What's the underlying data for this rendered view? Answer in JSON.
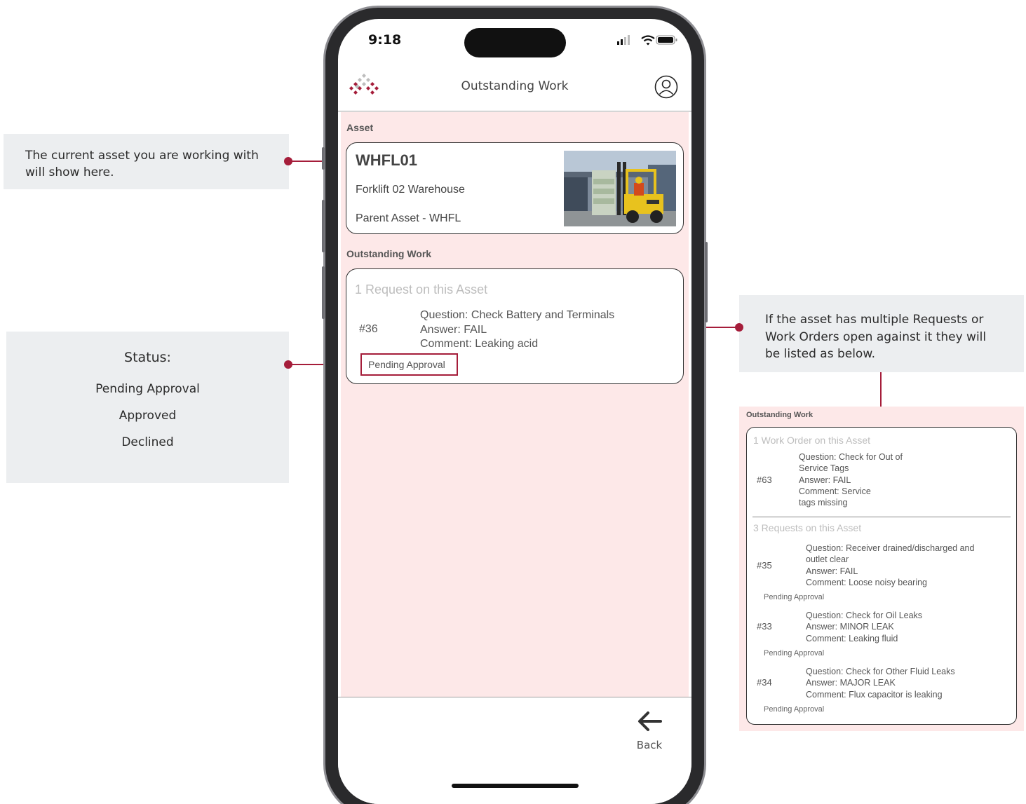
{
  "callouts": {
    "asset_line1": "The current asset you are working with",
    "asset_line2": "will show here.",
    "status_title": "Status:",
    "status_items": [
      "Pending Approval",
      "Approved",
      "Declined"
    ],
    "multi_line1": "If the asset has multiple Requests or",
    "multi_line2": "Work Orders open against it they will",
    "multi_line3": "be listed as below."
  },
  "device": {
    "time": "9:18"
  },
  "app": {
    "title": "Outstanding Work",
    "logo_icon": "diamond-grid-logo",
    "profile_icon": "user-circle-icon",
    "brand_color": "#a51d3a"
  },
  "asset": {
    "section_label": "Asset",
    "id": "WHFL01",
    "description": "Forklift 02 Warehouse",
    "parent": "Parent Asset - WHFL"
  },
  "outstanding": {
    "section_label": "Outstanding Work",
    "heading": "1 Request on this Asset",
    "item": {
      "number": "#36",
      "question": "Question: Check Battery and Terminals",
      "answer": "Answer: FAIL",
      "comment": "Comment: Leaking acid",
      "status": "Pending Approval"
    }
  },
  "nav": {
    "back_label": "Back",
    "back_icon": "arrow-left-icon"
  },
  "example": {
    "section_label": "Outstanding Work",
    "work_orders_heading": "1 Work Order on this Asset",
    "work_order": {
      "number": "#63",
      "question_l1": "Question: Check for Out of",
      "question_l2": "Service Tags",
      "answer": "Answer: FAIL",
      "comment_l1": "Comment: Service",
      "comment_l2": "tags missing"
    },
    "requests_heading": "3 Requests on this Asset",
    "requests": [
      {
        "number": "#35",
        "question_l1": "Question: Receiver drained/discharged and",
        "question_l2": "outlet clear",
        "answer": "Answer: FAIL",
        "comment": "Comment: Loose noisy bearing",
        "status": "Pending Approval"
      },
      {
        "number": "#33",
        "question_l1": "Question: Check for Oil Leaks",
        "answer": "Answer: MINOR LEAK",
        "comment": "Comment: Leaking fluid",
        "status": "Pending Approval"
      },
      {
        "number": "#34",
        "question_l1": "Question: Check for Other Fluid Leaks",
        "answer": "Answer: MAJOR LEAK",
        "comment": "Comment: Flux capacitor is leaking",
        "status": "Pending Approval"
      }
    ]
  }
}
